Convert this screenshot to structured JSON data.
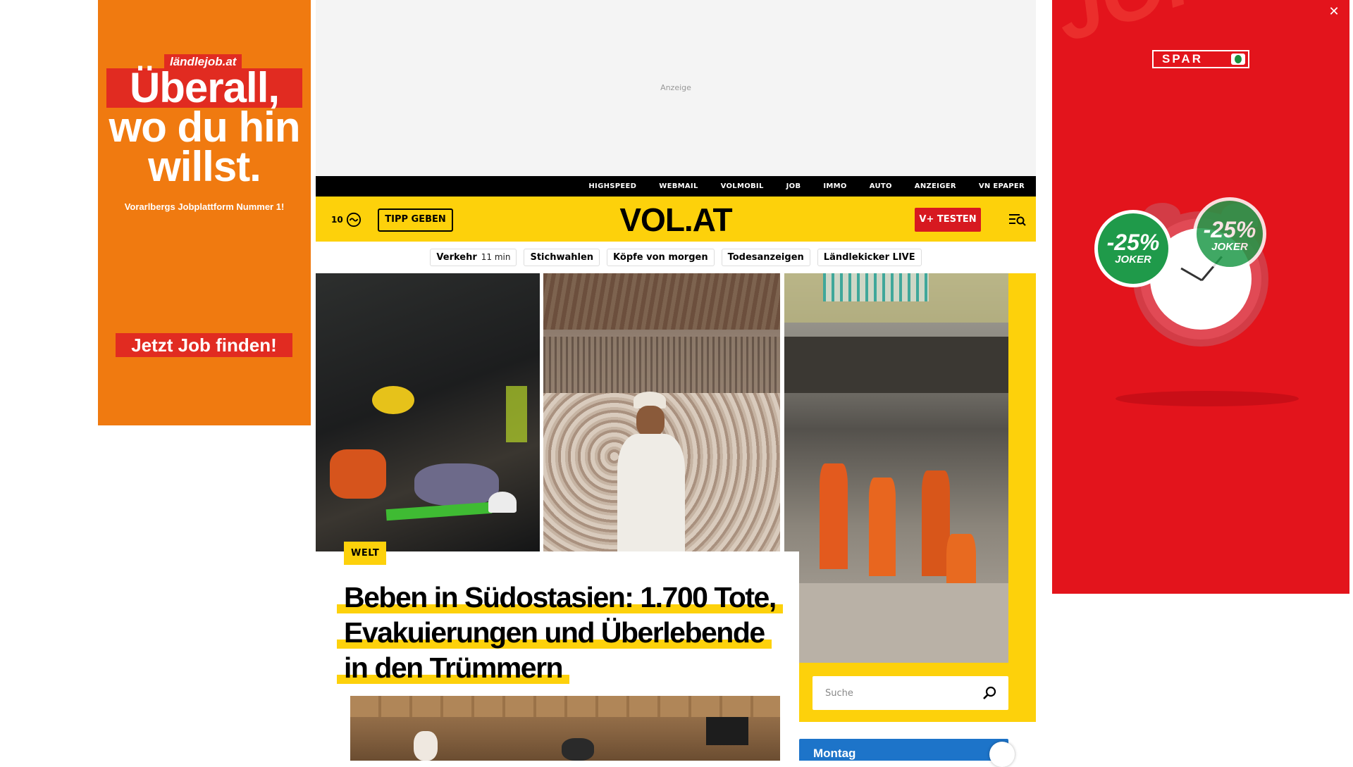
{
  "ads": {
    "left": {
      "brand": "ländlejob.at",
      "headline": [
        "Überall,",
        "wo du hin",
        "willst."
      ],
      "subline": "Vorarlbergs Jobplattform Nummer 1!",
      "cta": "Jetzt Job finden!",
      "background_color": "#f07a10",
      "accent_color": "#e12b21"
    },
    "top": {
      "label": "Anzeige"
    },
    "right": {
      "brand": "SPAR",
      "background_text": "JOKEN JOKEN",
      "badge_1": {
        "value": "-25%",
        "label": "JOKER"
      },
      "badge_2": {
        "value": "-25%",
        "label": "JOKER"
      },
      "background_color": "#e3141c",
      "close_label": "✕"
    }
  },
  "topnav": {
    "items": [
      "HIGHSPEED",
      "WEBMAIL",
      "VOLMOBIL",
      "JOB",
      "IMMO",
      "AUTO",
      "ANZEIGER",
      "VN EPAPER"
    ]
  },
  "header": {
    "weather_temp": "10",
    "weather_icon": "cloud-icon",
    "tipp_label": "TIPP GEBEN",
    "logo": "VOL.AT",
    "vplus_label": "V+ TESTEN",
    "menu_icon": "menu-search-icon",
    "brand_color": "#fdd10b",
    "vplus_color": "#d71920"
  },
  "quicklinks": [
    {
      "label": "Verkehr",
      "meta": "11 min"
    },
    {
      "label": "Stichwahlen",
      "meta": ""
    },
    {
      "label": "Köpfe von morgen",
      "meta": ""
    },
    {
      "label": "Todesanzeigen",
      "meta": ""
    },
    {
      "label": "Ländlekicker LIVE",
      "meta": ""
    }
  ],
  "hero": {
    "category": "WELT",
    "headline": "Beben in Südostasien: 1.700 Tote, Evakuierungen und Überlebende in den Trümmern"
  },
  "search": {
    "placeholder": "Suche",
    "icon": "search-icon"
  },
  "weather_widget": {
    "day": "Montag",
    "color": "#1d74c9"
  }
}
